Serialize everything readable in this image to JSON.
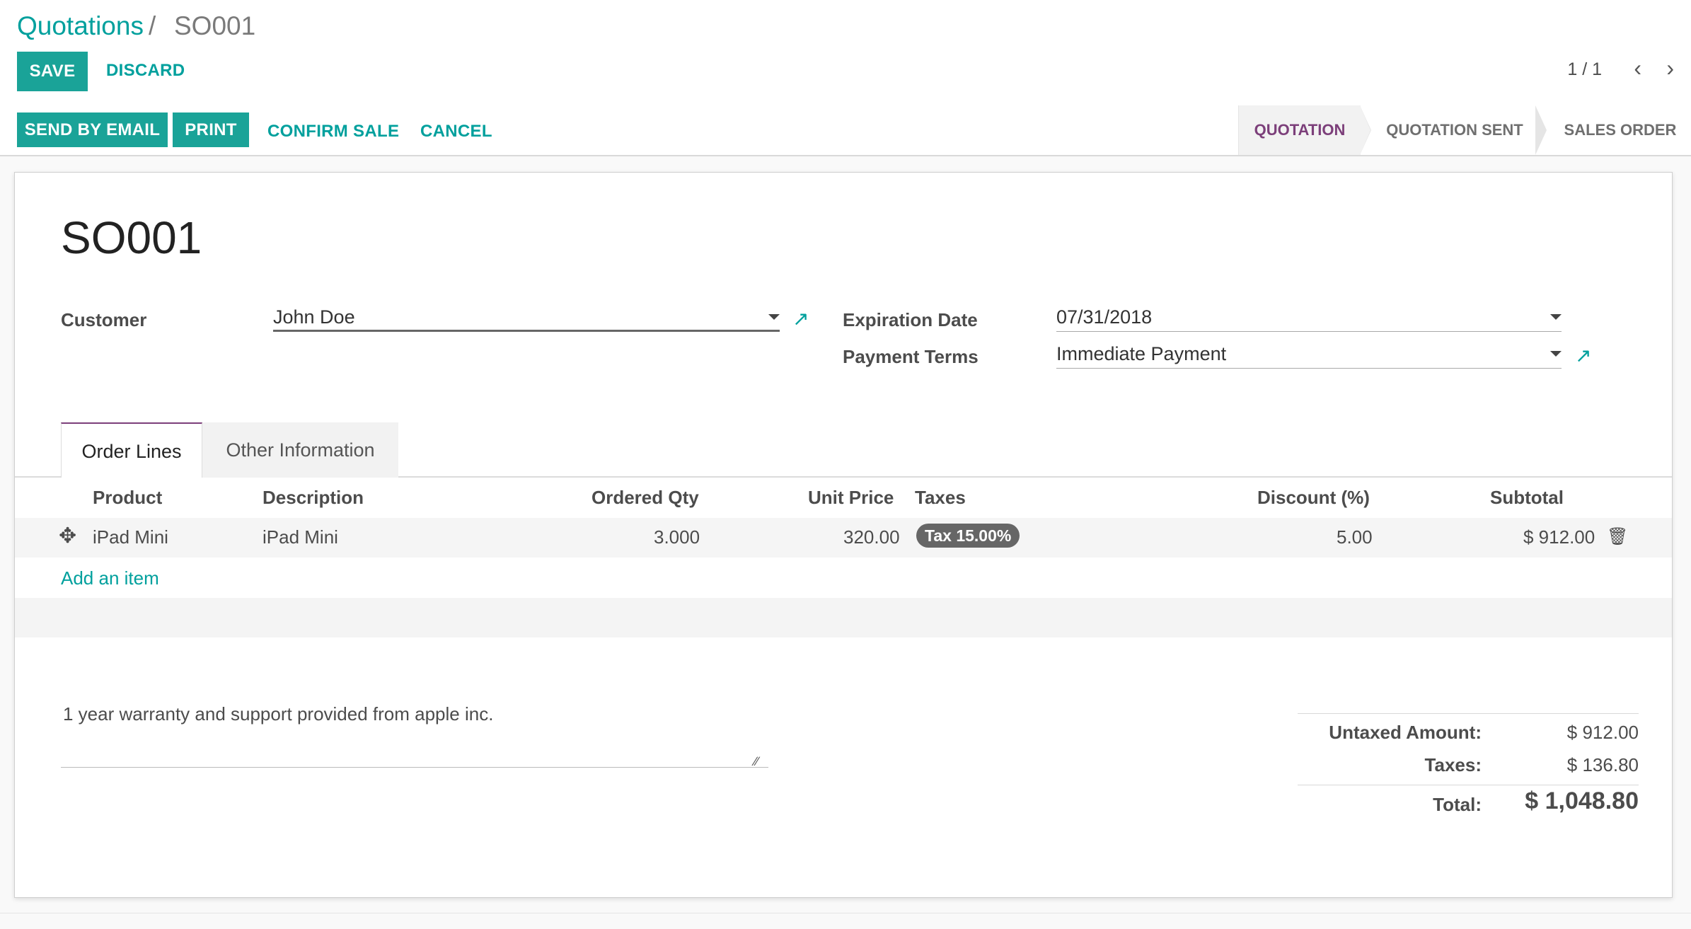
{
  "breadcrumb": {
    "parent": "Quotations",
    "separator": "/",
    "current": "SO001"
  },
  "control": {
    "save": "SAVE",
    "discard": "DISCARD"
  },
  "pager": {
    "value": "1 / 1",
    "prev_icon": "chevron-left-icon",
    "next_icon": "chevron-right-icon"
  },
  "actions": {
    "send_email": "SEND BY EMAIL",
    "print": "PRINT",
    "confirm": "CONFIRM SALE",
    "cancel": "CANCEL"
  },
  "statusbar": {
    "stages": [
      "QUOTATION",
      "QUOTATION SENT",
      "SALES ORDER"
    ],
    "active": "QUOTATION"
  },
  "record": {
    "name": "SO001",
    "customer_label": "Customer",
    "customer_value": "John Doe",
    "expiration_label": "Expiration Date",
    "expiration_value": "07/31/2018",
    "payment_terms_label": "Payment Terms",
    "payment_terms_value": "Immediate Payment"
  },
  "tabs": [
    {
      "label": "Order Lines",
      "active": true
    },
    {
      "label": "Other Information",
      "active": false
    }
  ],
  "table": {
    "headers": [
      "Product",
      "Description",
      "Ordered Qty",
      "Unit Price",
      "Taxes",
      "Discount (%)",
      "Subtotal"
    ],
    "rows": [
      {
        "product": "iPad Mini",
        "description": "iPad Mini",
        "qty": "3.000",
        "unit_price": "320.00",
        "tax": "Tax 15.00%",
        "discount": "5.00",
        "subtotal": "$ 912.00"
      }
    ],
    "add_item": "Add an item"
  },
  "note": "1 year warranty and support provided from apple inc.",
  "totals": {
    "untaxed_label": "Untaxed Amount:",
    "untaxed_value": "$ 912.00",
    "taxes_label": "Taxes:",
    "taxes_value": "$ 136.80",
    "total_label": "Total:",
    "total_value": "$ 1,048.80"
  },
  "colors": {
    "accent": "#00a09d",
    "primary_button": "#1aa398",
    "stage_active": "#7c3f7a"
  }
}
